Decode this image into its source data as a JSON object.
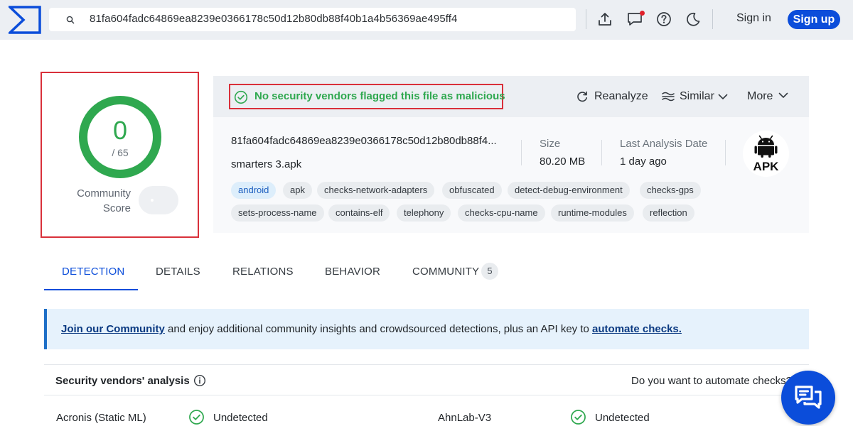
{
  "header": {
    "search_value": "81fa604fadc64869ea8239e0366178c50d12b80db88f40b1a4b56369ae495ff4",
    "signin_label": "Sign in",
    "signup_label": "Sign up"
  },
  "community_score": {
    "value": "0",
    "total": "/ 65",
    "label_line1": "Community",
    "label_line2": "Score"
  },
  "result": {
    "verdict": "No security vendors flagged this file as malicious",
    "actions": {
      "reanalyze": "Reanalyze",
      "similar": "Similar",
      "more": "More"
    },
    "hash_display": "81fa604fadc64869ea8239e0366178c50d12b80db88f4...",
    "file_name": "smarters 3.apk",
    "size_label": "Size",
    "size_value": "80.20 MB",
    "date_label": "Last Analysis Date",
    "date_value": "1 day ago",
    "file_type": "APK",
    "tags": [
      "android",
      "apk",
      "checks-network-adapters",
      "obfuscated",
      "detect-debug-environment",
      "checks-gps",
      "sets-process-name",
      "contains-elf",
      "telephony",
      "checks-cpu-name",
      "runtime-modules",
      "reflection"
    ]
  },
  "tabs": [
    {
      "label": "DETECTION",
      "active": true
    },
    {
      "label": "DETAILS"
    },
    {
      "label": "RELATIONS"
    },
    {
      "label": "BEHAVIOR"
    },
    {
      "label": "COMMUNITY",
      "badge": "5"
    }
  ],
  "banner": {
    "link1": "Join our Community",
    "text": " and enjoy additional community insights and crowdsourced detections, plus an API key to ",
    "link2": "automate checks."
  },
  "vendors": {
    "title": "Security vendors' analysis",
    "automate_text": "Do you want to automate checks?",
    "rows": [
      {
        "name": "Acronis (Static ML)",
        "result": "Undetected"
      },
      {
        "name": "AhnLab-V3",
        "result": "Undetected"
      }
    ]
  },
  "colors": {
    "brand": "#0b4dda",
    "clean": "#2fa84f",
    "highlight_border": "#d9303a"
  }
}
